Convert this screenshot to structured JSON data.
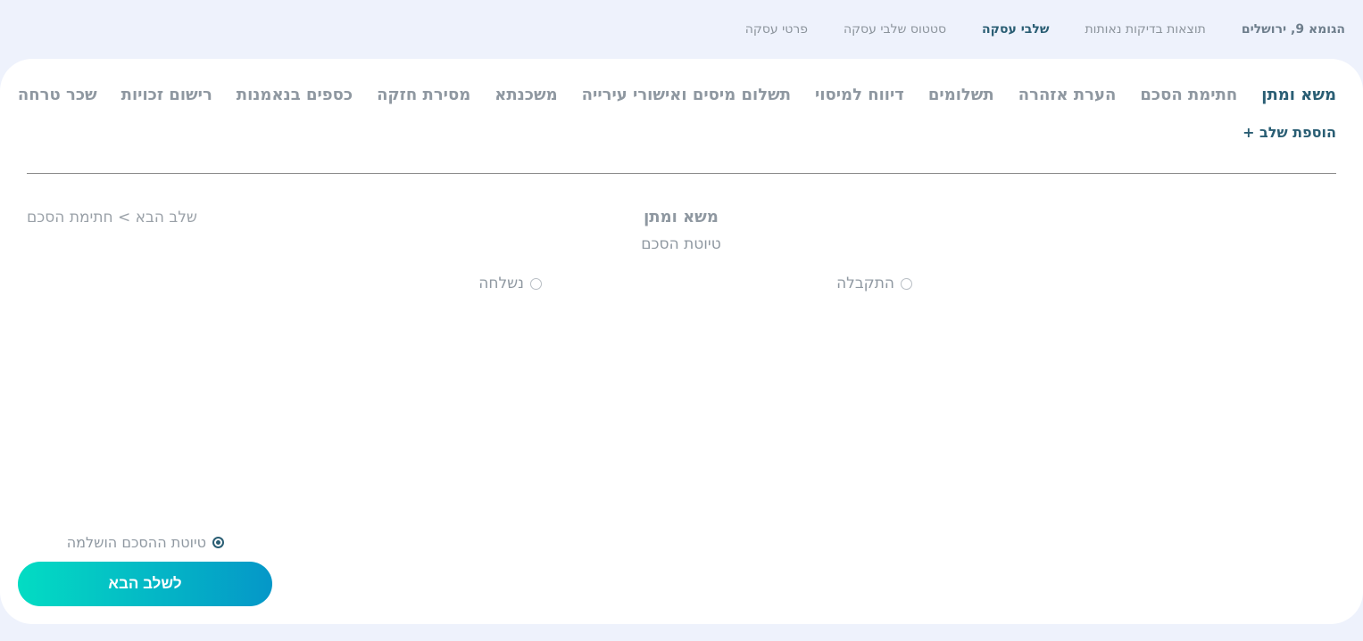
{
  "topnav": {
    "address": "הגומא 9, ירושלים",
    "items": [
      "תוצאות בדיקות נאותות",
      "שלבי עסקה",
      "סטטוס שלבי עסקה",
      "פרטי עסקה"
    ],
    "active_index": 1
  },
  "tabs": [
    "משא ומתן",
    "חתימת הסכם",
    "הערת אזהרה",
    "תשלומים",
    "דיווח למיסוי",
    "תשלום מיסים ואישורי עירייה",
    "משכנתא",
    "מסירת חזקה",
    "כספים בנאמנות",
    "רישום זכויות",
    "שכר טרחה"
  ],
  "add_step_label": "הוספת שלב +",
  "next_step_link": "שלב הבא > חתימת הסכם",
  "stage": {
    "title": "משא ומתן",
    "subtitle": "טיוטת הסכם",
    "option_received": "התקבלה",
    "option_sent": "נשלחה",
    "option_complete": "טיוטת ההסכם הושלמה"
  },
  "next_button_label": "לשלב הבא",
  "colors": {
    "accent": "#2a5e74",
    "background": "#eef2fc",
    "gradient_start": "#03dcc3",
    "gradient_end": "#0597c8"
  }
}
